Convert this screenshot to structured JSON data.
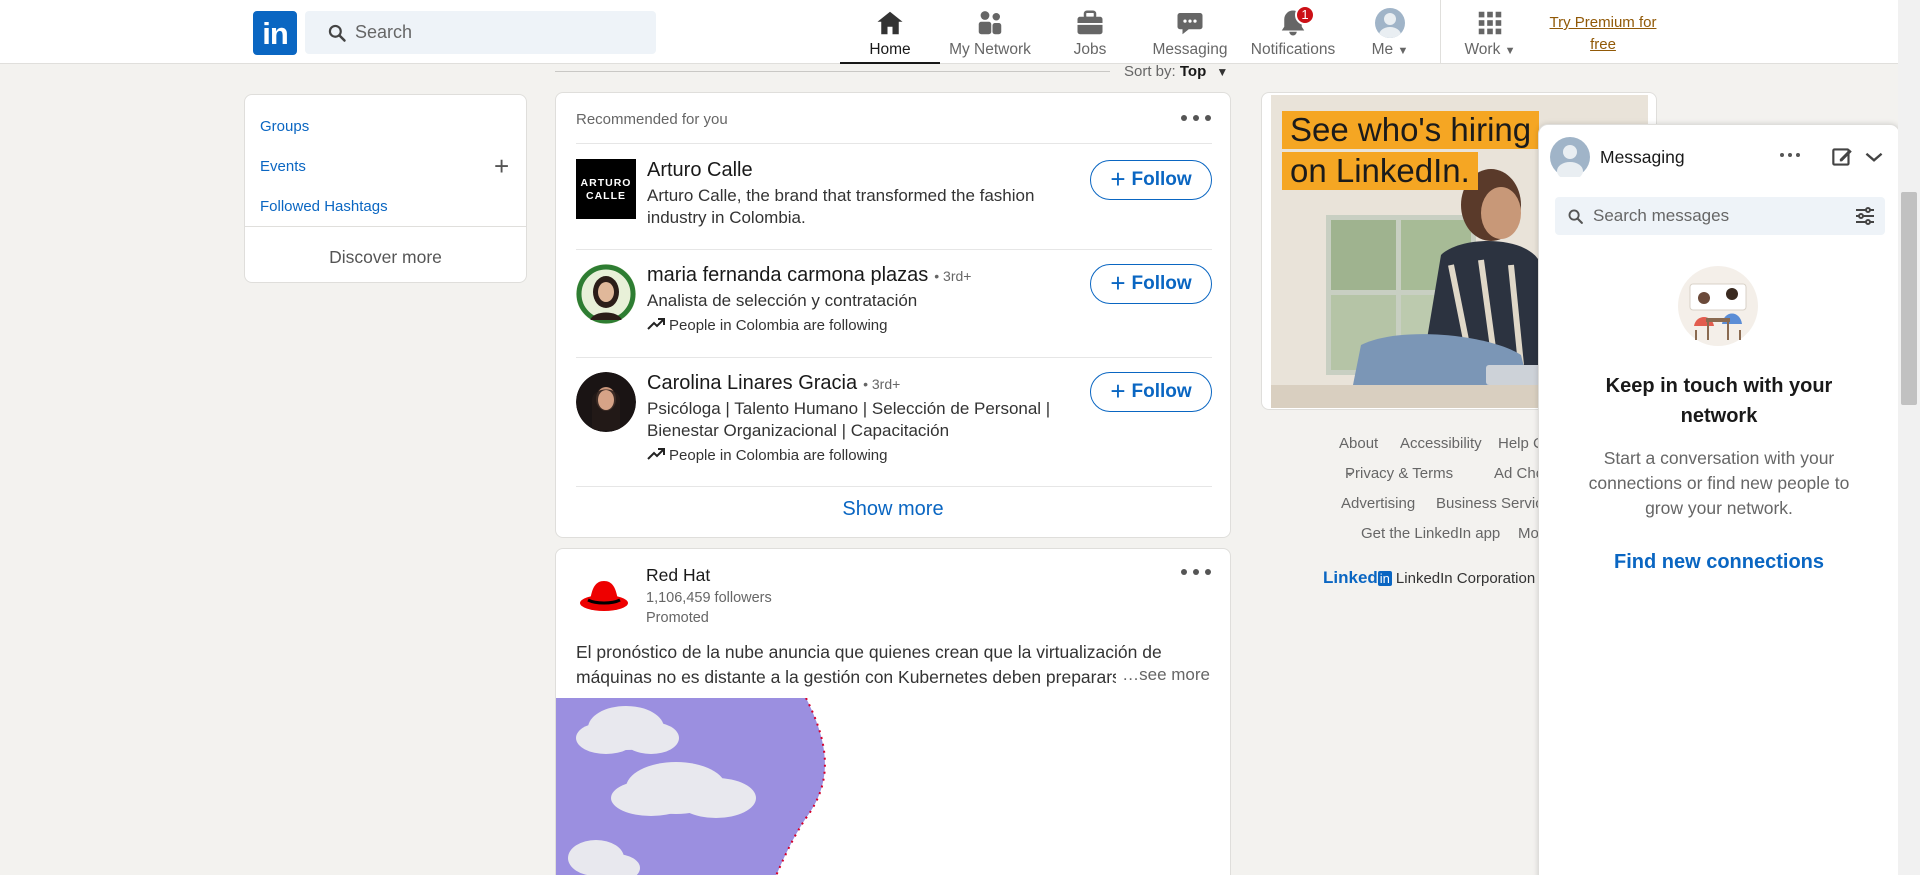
{
  "header": {
    "logo_text": "in",
    "search_placeholder": "Search",
    "nav": {
      "home": "Home",
      "network": "My Network",
      "jobs": "Jobs",
      "messaging": "Messaging",
      "notifications": "Notifications",
      "notifications_badge": "1",
      "me": "Me",
      "work": "Work"
    },
    "premium": "Try Premium for free"
  },
  "sidebar": {
    "groups": "Groups",
    "events": "Events",
    "hashtags": "Followed Hashtags",
    "discover": "Discover more"
  },
  "feed": {
    "sort_label": "Sort by:",
    "sort_value": "Top",
    "recommended": {
      "header": "Recommended for you",
      "follow_label": "Follow",
      "show_more": "Show more",
      "people": [
        {
          "name": "Arturo Calle",
          "degree": "",
          "description": "Arturo Calle, the brand that transformed the fashion industry in Colombia.",
          "trend": "",
          "logo_line1": "ARTURO",
          "logo_line2": "CALLE"
        },
        {
          "name": "maria fernanda carmona plazas",
          "degree": "• 3rd+",
          "description": "Analista de selección y contratación",
          "trend": "People in Colombia are following"
        },
        {
          "name": "Carolina Linares Gracia",
          "degree": "• 3rd+",
          "description": "Psicóloga | Talento Humano | Selección de Personal | Bienestar Organizacional | Capacitación",
          "trend": "People in Colombia are following"
        }
      ]
    },
    "post": {
      "company": "Red Hat",
      "followers": "1,106,459 followers",
      "promoted": "Promoted",
      "text": "El pronóstico de la nube anuncia que quienes crean que la virtualización de máquinas no es distante a la gestión con Kubernetes deben prepararse",
      "see_more": "…see more"
    }
  },
  "ad": {
    "line1": "See who's hiring",
    "line2": "on LinkedIn."
  },
  "footer": {
    "about": "About",
    "accessibility": "Accessibility",
    "help": "Help C",
    "privacy": "Privacy & Terms",
    "adchoices": "Ad Cho",
    "advertising": "Advertising",
    "business": "Business Servic",
    "getapp": "Get the LinkedIn app",
    "more": "Mo",
    "corp_logo": "Linked",
    "corp_logo_in": "in",
    "corp": "LinkedIn Corporation"
  },
  "messaging": {
    "title": "Messaging",
    "search_placeholder": "Search messages",
    "headline": "Keep in touch with your network",
    "subtext": "Start a conversation with your connections or find new people to grow your network.",
    "cta": "Find new connections"
  },
  "colors": {
    "brand": "#0a66c2",
    "badge": "#cc1016",
    "premium": "#915907",
    "ad_highlight": "#f5a623"
  }
}
